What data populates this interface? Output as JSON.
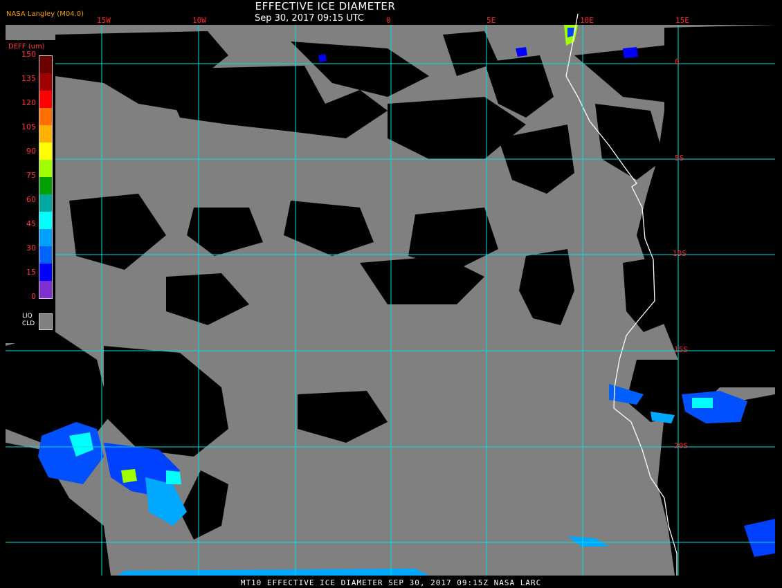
{
  "header": {
    "title": "EFFECTIVE ICE DIAMETER",
    "subtitle": "Sep 30, 2017 09:15 UTC",
    "source": "NASA Langley (M04.0)"
  },
  "footer": {
    "text": "MT10  EFFECTIVE ICE DIAMETER  SEP 30, 2017 09:15Z  NASA LARC"
  },
  "map": {
    "longitude_labels": [
      "15W",
      "10W",
      "0",
      "5E",
      "10E",
      "15E"
    ],
    "latitude_labels": [
      "0",
      "5S",
      "10S",
      "15S",
      "20S"
    ],
    "colors": {
      "background": "#000000",
      "liquid_cloud": "#808080",
      "grid": "#00e0e0",
      "coast": "#ffffff",
      "labels": "#ff2a2a"
    }
  },
  "legend": {
    "title": "DEFF (um)",
    "ticks": [
      "150",
      "135",
      "120",
      "105",
      "90",
      "75",
      "60",
      "45",
      "30",
      "15",
      "0"
    ],
    "colors": [
      "#6b0000",
      "#a00000",
      "#ff0000",
      "#ff7000",
      "#ffb000",
      "#ffff00",
      "#a0ff00",
      "#00a000",
      "#00a8a0",
      "#00ffff",
      "#00a0ff",
      "#0064ff",
      "#0000ff",
      "#8030d0"
    ],
    "liq_label_1": "LIQ",
    "liq_label_2": "CLD"
  }
}
